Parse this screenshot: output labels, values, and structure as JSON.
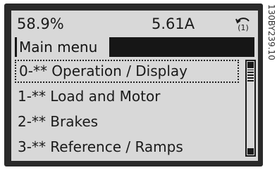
{
  "status": {
    "reading_1": "58.9%",
    "reading_2": "5.61A",
    "setup_indicator": "(1)",
    "setup_icon": "setup-cycle-icon"
  },
  "title": "Main menu",
  "menu": {
    "items": [
      {
        "label": "0-** Operation / Display",
        "selected": true
      },
      {
        "label": "1-** Load and Motor",
        "selected": false
      },
      {
        "label": "2-** Brakes",
        "selected": false
      },
      {
        "label": "3-** Reference / Ramps",
        "selected": false
      }
    ]
  },
  "scroll": {
    "up_icon": "scroll-up-icon",
    "down_icon": "scroll-down-icon"
  },
  "figure_code": "130BY239.10",
  "colors": {
    "lcd_background": "#d8d8d8",
    "lcd_text": "#1a1a1a",
    "bezel": "#2a2a2a"
  }
}
